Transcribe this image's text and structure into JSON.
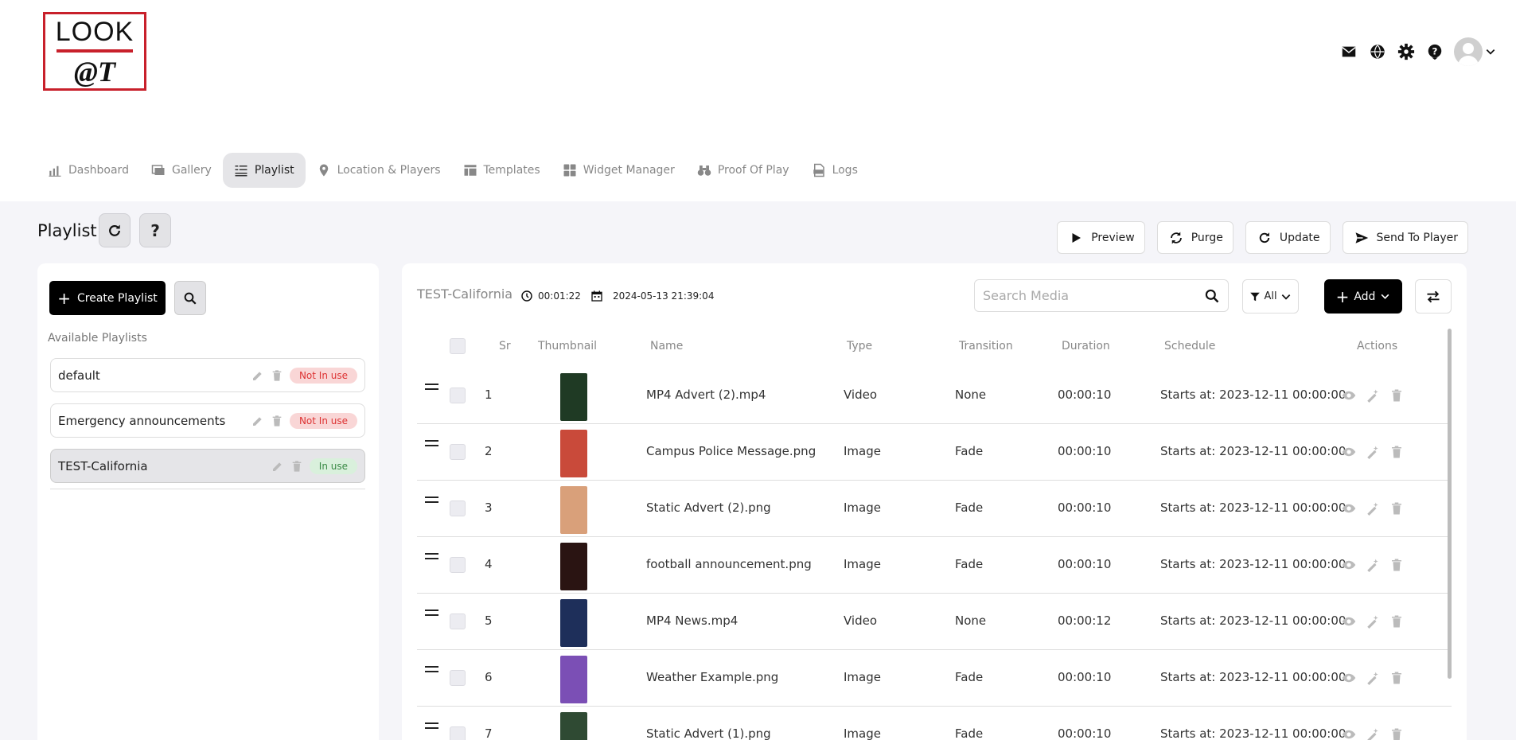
{
  "brand": {
    "logo_top": "LOOK",
    "logo_bottom": "@T"
  },
  "header_icons": [
    "mail-icon",
    "globe-icon",
    "gear-icon",
    "help-icon",
    "avatar",
    "chevron-down-icon"
  ],
  "nav": [
    {
      "label": "Dashboard",
      "icon": "dashboard-icon"
    },
    {
      "label": "Gallery",
      "icon": "gallery-icon"
    },
    {
      "label": "Playlist",
      "icon": "playlist-icon",
      "active": true
    },
    {
      "label": "Location & Players",
      "icon": "location-icon"
    },
    {
      "label": "Templates",
      "icon": "templates-icon"
    },
    {
      "label": "Widget Manager",
      "icon": "widget-icon"
    },
    {
      "label": "Proof Of Play",
      "icon": "binoculars-icon"
    },
    {
      "label": "Logs",
      "icon": "logs-icon"
    }
  ],
  "page": {
    "title": "Playlist",
    "help": "?"
  },
  "actions": {
    "preview": "Preview",
    "purge": "Purge",
    "update": "Update",
    "send": "Send To Player"
  },
  "left": {
    "create_label": "Create Playlist",
    "available_label": "Available Playlists",
    "playlists": [
      {
        "name": "default",
        "status": "Not In use",
        "status_color": "#d33"
      },
      {
        "name": "Emergency announcements",
        "status": "Not In use",
        "status_color": "#d33"
      },
      {
        "name": "TEST-California",
        "status": "In use",
        "status_color": "#3a8a46",
        "selected": true
      }
    ]
  },
  "detail": {
    "name": "TEST-California",
    "duration": "00:01:22",
    "date": "2024-05-13 21:39:04",
    "search_placeholder": "Search Media",
    "filter_label": "All",
    "add_label": "Add",
    "columns": {
      "sr": "Sr",
      "thumbnail": "Thumbnail",
      "name": "Name",
      "type": "Type",
      "transition": "Transition",
      "duration": "Duration",
      "schedule": "Schedule",
      "actions": "Actions"
    },
    "rows": [
      {
        "sr": "1",
        "name": "MP4 Advert (2).mp4",
        "type": "Video",
        "transition": "None",
        "duration": "00:00:10",
        "schedule": "Starts at: 2023-12-11 00:00:00",
        "thumb_color": "#1f3a24"
      },
      {
        "sr": "2",
        "name": "Campus Police Message.png",
        "type": "Image",
        "transition": "Fade",
        "duration": "00:00:10",
        "schedule": "Starts at: 2023-12-11 00:00:00",
        "thumb_color": "#c94a3a"
      },
      {
        "sr": "3",
        "name": "Static Advert (2).png",
        "type": "Image",
        "transition": "Fade",
        "duration": "00:00:10",
        "schedule": "Starts at: 2023-12-11 00:00:00",
        "thumb_color": "#d9a07a"
      },
      {
        "sr": "4",
        "name": "football announcement.png",
        "type": "Image",
        "transition": "Fade",
        "duration": "00:00:10",
        "schedule": "Starts at: 2023-12-11 00:00:00",
        "thumb_color": "#2a1412"
      },
      {
        "sr": "5",
        "name": "MP4 News.mp4",
        "type": "Video",
        "transition": "None",
        "duration": "00:00:12",
        "schedule": "Starts at: 2023-12-11 00:00:00",
        "thumb_color": "#1e2f5a"
      },
      {
        "sr": "6",
        "name": "Weather Example.png",
        "type": "Image",
        "transition": "Fade",
        "duration": "00:00:10",
        "schedule": "Starts at: 2023-12-11 00:00:00",
        "thumb_color": "#7b4fb5"
      },
      {
        "sr": "7",
        "name": "Static Advert (1).png",
        "type": "Image",
        "transition": "Fade",
        "duration": "00:00:10",
        "schedule": "Starts at: 2023-12-11 00:00:00",
        "thumb_color": "#2f4a33"
      }
    ]
  }
}
